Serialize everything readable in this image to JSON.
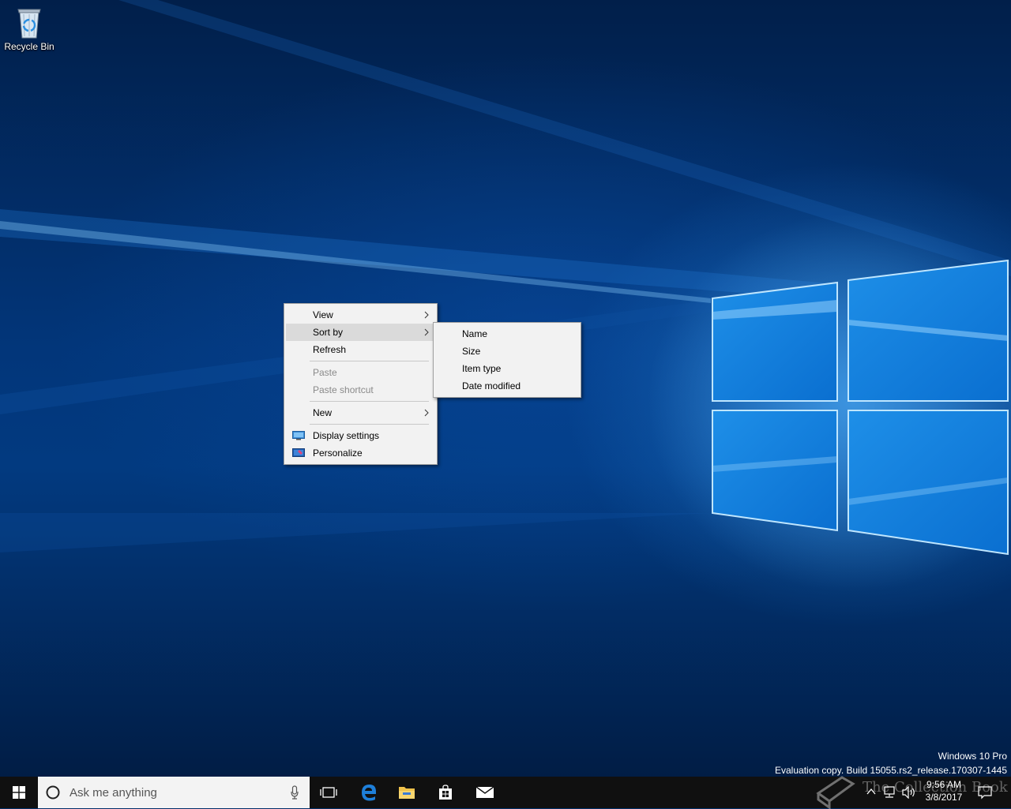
{
  "desktop": {
    "icons": [
      {
        "label": "Recycle Bin",
        "icon": "recycle-bin-icon"
      }
    ]
  },
  "context_menu": {
    "items": [
      {
        "label": "View",
        "submenu": true
      },
      {
        "label": "Sort by",
        "submenu": true,
        "highlighted": true
      },
      {
        "label": "Refresh"
      },
      {
        "label": "Paste",
        "disabled": true
      },
      {
        "label": "Paste shortcut",
        "disabled": true
      },
      {
        "label": "New",
        "submenu": true
      },
      {
        "label": "Display settings",
        "icon": "display-settings-icon"
      },
      {
        "label": "Personalize",
        "icon": "personalize-icon"
      }
    ]
  },
  "sort_submenu": {
    "items": [
      {
        "label": "Name"
      },
      {
        "label": "Size"
      },
      {
        "label": "Item type"
      },
      {
        "label": "Date modified"
      }
    ]
  },
  "watermark": {
    "edition": "Windows 10 Pro",
    "build": "Evaluation copy. Build 15055.rs2_release.170307-1445",
    "overlay_text": "The Collection Book"
  },
  "taskbar": {
    "search_placeholder": "Ask me anything",
    "pinned": [
      "task-view-icon",
      "edge-icon",
      "file-explorer-icon",
      "store-icon",
      "mail-icon"
    ],
    "clock_time": "9:56 AM",
    "clock_date": "3/8/2017"
  },
  "colors": {
    "taskbar": "#101010",
    "menu_bg": "#f2f2f2",
    "menu_highlight": "#dadada",
    "accent": "#0078d7"
  }
}
